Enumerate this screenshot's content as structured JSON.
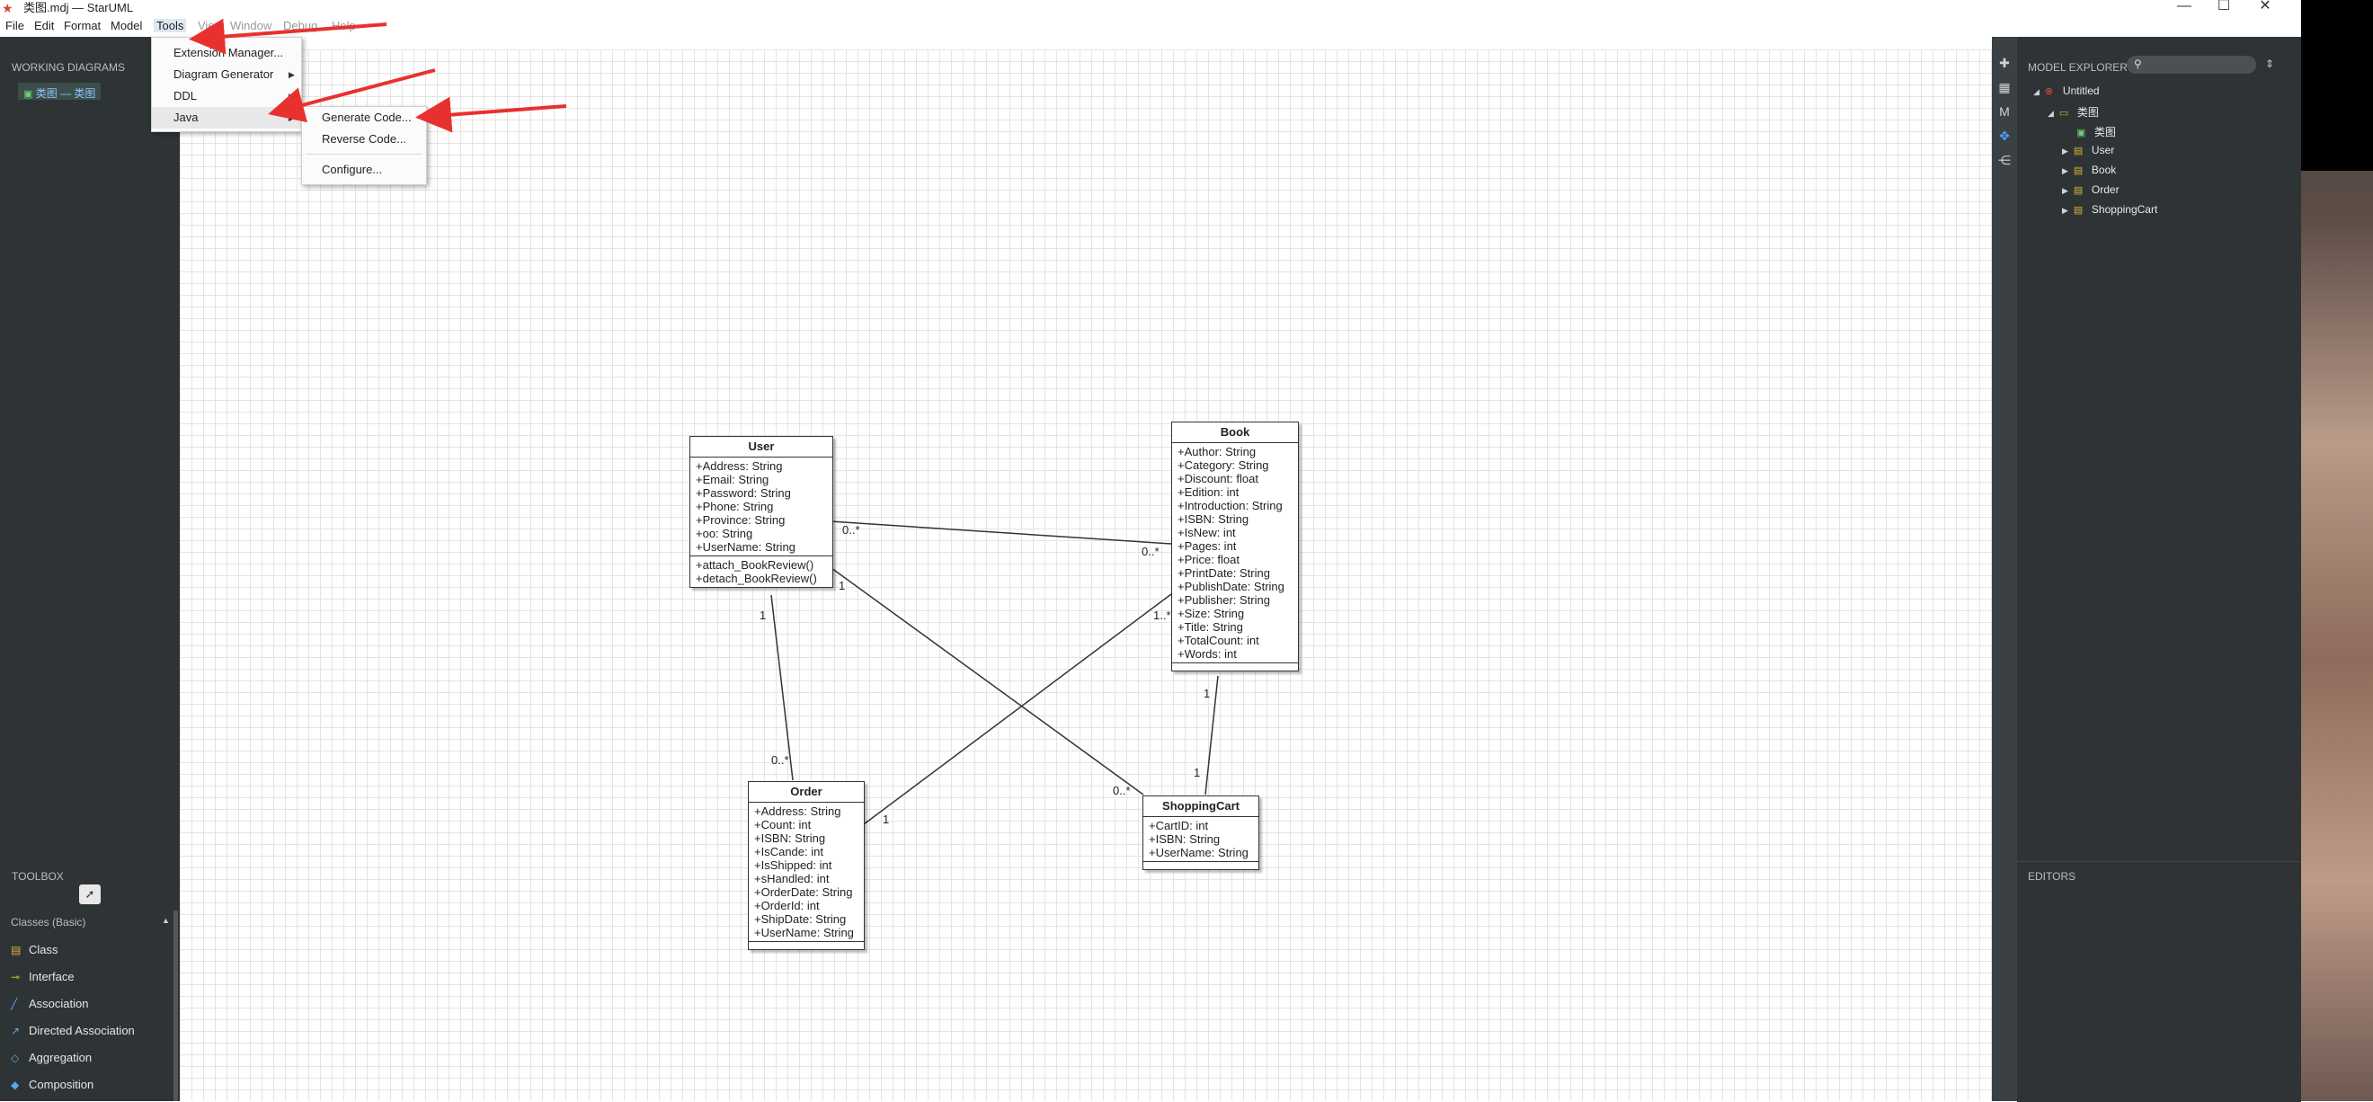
{
  "window": {
    "title": "类图.mdj — StarUML",
    "controls": {
      "minimize": "—",
      "maximize": "☐",
      "close": "✕"
    }
  },
  "menubar": {
    "file": "File",
    "edit": "Edit",
    "format": "Format",
    "model": "Model",
    "tools": "Tools",
    "view": "View",
    "window": "Window",
    "debug": "Debug",
    "help": "Help"
  },
  "tools_menu": {
    "items": [
      "Extension Manager...",
      "Diagram Generator",
      "DDL",
      "Java"
    ]
  },
  "java_submenu": {
    "items": [
      "Generate Code...",
      "Reverse Code...",
      "Configure..."
    ]
  },
  "left_panel": {
    "working_diagrams_heading": "WORKING DIAGRAMS",
    "working_item": "类图 — 类图",
    "toolbox_heading": "TOOLBOX",
    "classes_heading": "Classes (Basic)",
    "tools": [
      "Class",
      "Interface",
      "Association",
      "Directed Association",
      "Aggregation",
      "Composition"
    ]
  },
  "right_panel": {
    "model_explorer_heading": "MODEL EXPLORER",
    "editors_heading": "EDITORS",
    "tree": {
      "root": "Untitled",
      "diagram_folder": "类图",
      "diagram": "类图",
      "classes": [
        "User",
        "Book",
        "Order",
        "ShoppingCart"
      ]
    }
  },
  "diagram": {
    "user": {
      "name": "User",
      "attributes": [
        "+Address: String",
        "+Email: String",
        "+Password: String",
        "+Phone: String",
        "+Province: String",
        "+oo: String",
        "+UserName: String"
      ],
      "operations": [
        "+attach_BookReview()",
        "+detach_BookReview()"
      ]
    },
    "book": {
      "name": "Book",
      "attributes": [
        "+Author: String",
        "+Category: String",
        "+Discount: float",
        "+Edition: int",
        "+Introduction: String",
        "+ISBN: String",
        "+IsNew: int",
        "+Pages: int",
        "+Price: float",
        "+PrintDate: String",
        "+PublishDate: String",
        "+Publisher: String",
        "+Size: String",
        "+Title: String",
        "+TotalCount: int",
        "+Words: int"
      ]
    },
    "order": {
      "name": "Order",
      "attributes": [
        "+Address: String",
        "+Count: int",
        "+ISBN: String",
        "+IsCande: int",
        "+IsShipped: int",
        "+sHandled: int",
        "+OrderDate: String",
        "+OrderId: int",
        "+ShipDate: String",
        "+UserName: String"
      ]
    },
    "cart": {
      "name": "ShoppingCart",
      "attributes": [
        "+CartID: int",
        "+ISBN: String",
        "+UserName: String"
      ]
    },
    "multiplicities": {
      "user_book_user": "0..*",
      "user_book_book": "0..*",
      "user_cart_user": "1",
      "user_cart_cart": "0..*",
      "user_order_user": "1",
      "user_order_order": "0..*",
      "order_book_order": "1",
      "order_book_book": "1..*",
      "book_cart_book": "1",
      "book_cart_cart": "1"
    }
  },
  "colors": {
    "annotation_arrow": "#e8312f",
    "panel": "#2e3336",
    "canvas_grid": "#e4e4e4"
  }
}
